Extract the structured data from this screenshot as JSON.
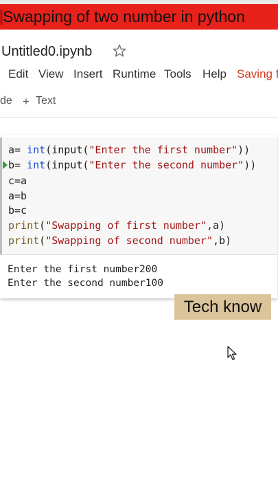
{
  "video": {
    "title": "Swapping of two number in python",
    "watermark": "Tech know"
  },
  "notebook": {
    "name": "Untitled0.ipynb",
    "menu": [
      "Edit",
      "View",
      "Insert",
      "Runtime",
      "Tools",
      "Help"
    ],
    "status": "Saving fa",
    "toolbar": {
      "code_fragment": "de",
      "plus": "+",
      "add_text": "Text"
    }
  },
  "cell": {
    "code_lines": [
      "a= int(input(\"Enter the first number\"))",
      "b= int(input(\"Enter the second number\"))",
      "c=a",
      "a=b",
      "b=c",
      "print(\"Swapping of first number\",a)",
      "print(\"Swapping of second number\",b)"
    ],
    "output_lines": [
      "Enter the first number200",
      "Enter the second number100"
    ]
  },
  "colors": {
    "banner": "#e8211b",
    "watermark_bg": "#dcc49a",
    "keyword": "#1a52c9",
    "string": "#a31515",
    "status": "#d2391c"
  }
}
